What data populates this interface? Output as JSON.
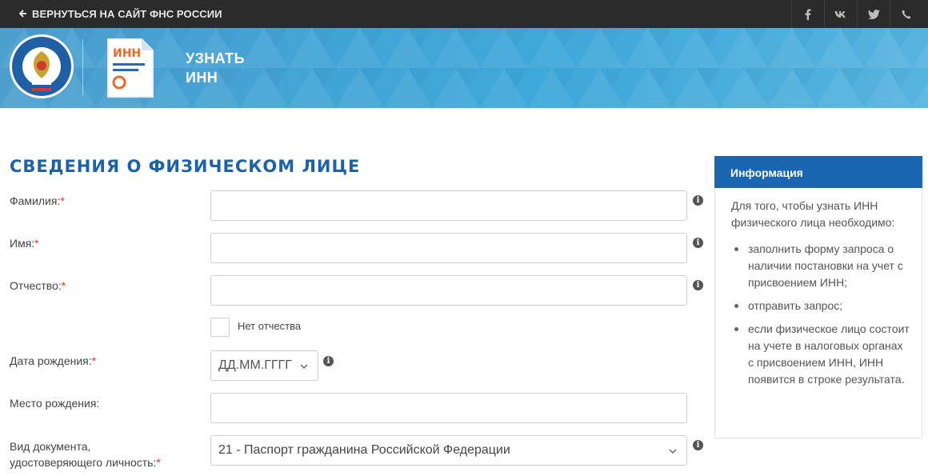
{
  "topbar": {
    "back_label": "ВЕРНУТЬСЯ НА САЙТ ФНС РОССИИ",
    "social_icons": [
      "facebook-icon",
      "vk-icon",
      "twitter-icon",
      "phone-icon"
    ]
  },
  "banner": {
    "logo_text": "ФЕДЕРАЛЬНАЯ НАЛОГОВАЯ СЛУЖБА",
    "doc_icon_text": "ИНН",
    "title_line1": "УЗНАТЬ",
    "title_line2": "ИНН"
  },
  "form": {
    "section_title": "СВЕДЕНИЯ О ФИЗИЧЕСКОМ ЛИЦЕ",
    "fields": {
      "surname": {
        "label": "Фамилия:",
        "required": "*",
        "value": ""
      },
      "name": {
        "label": "Имя:",
        "required": "*",
        "value": ""
      },
      "patronymic": {
        "label": "Отчество:",
        "required": "*",
        "value": ""
      },
      "no_patronymic": {
        "label": "Нет отчества",
        "checked": false
      },
      "birth_date": {
        "label": "Дата рождения:",
        "required": "*",
        "placeholder": "ДД.ММ.ГГГГ"
      },
      "birth_place": {
        "label": "Место рождения:",
        "value": ""
      },
      "doc_type": {
        "label_line1": "Вид документа,",
        "label_line2": "удостоверяющего личность:",
        "required": "*",
        "value": "21 - Паспорт гражданина Российской Федерации"
      }
    }
  },
  "info_panel": {
    "title": "Информация",
    "intro": "Для того, чтобы узнать ИНН физического лица необходимо:",
    "items": [
      "заполнить форму запроса о наличии постановки на учет с присвоением ИНН;",
      "отправить запрос;",
      "если физическое лицо состоит на учете в налоговых органах с присвоением ИНН, ИНН появится в строке результата."
    ]
  },
  "colors": {
    "topbar_bg": "#2b2b2b",
    "banner_bg": "#42a4d6",
    "section_title": "#1c62a8",
    "panel_header": "#1a66b3",
    "required_star": "#d9332e"
  }
}
